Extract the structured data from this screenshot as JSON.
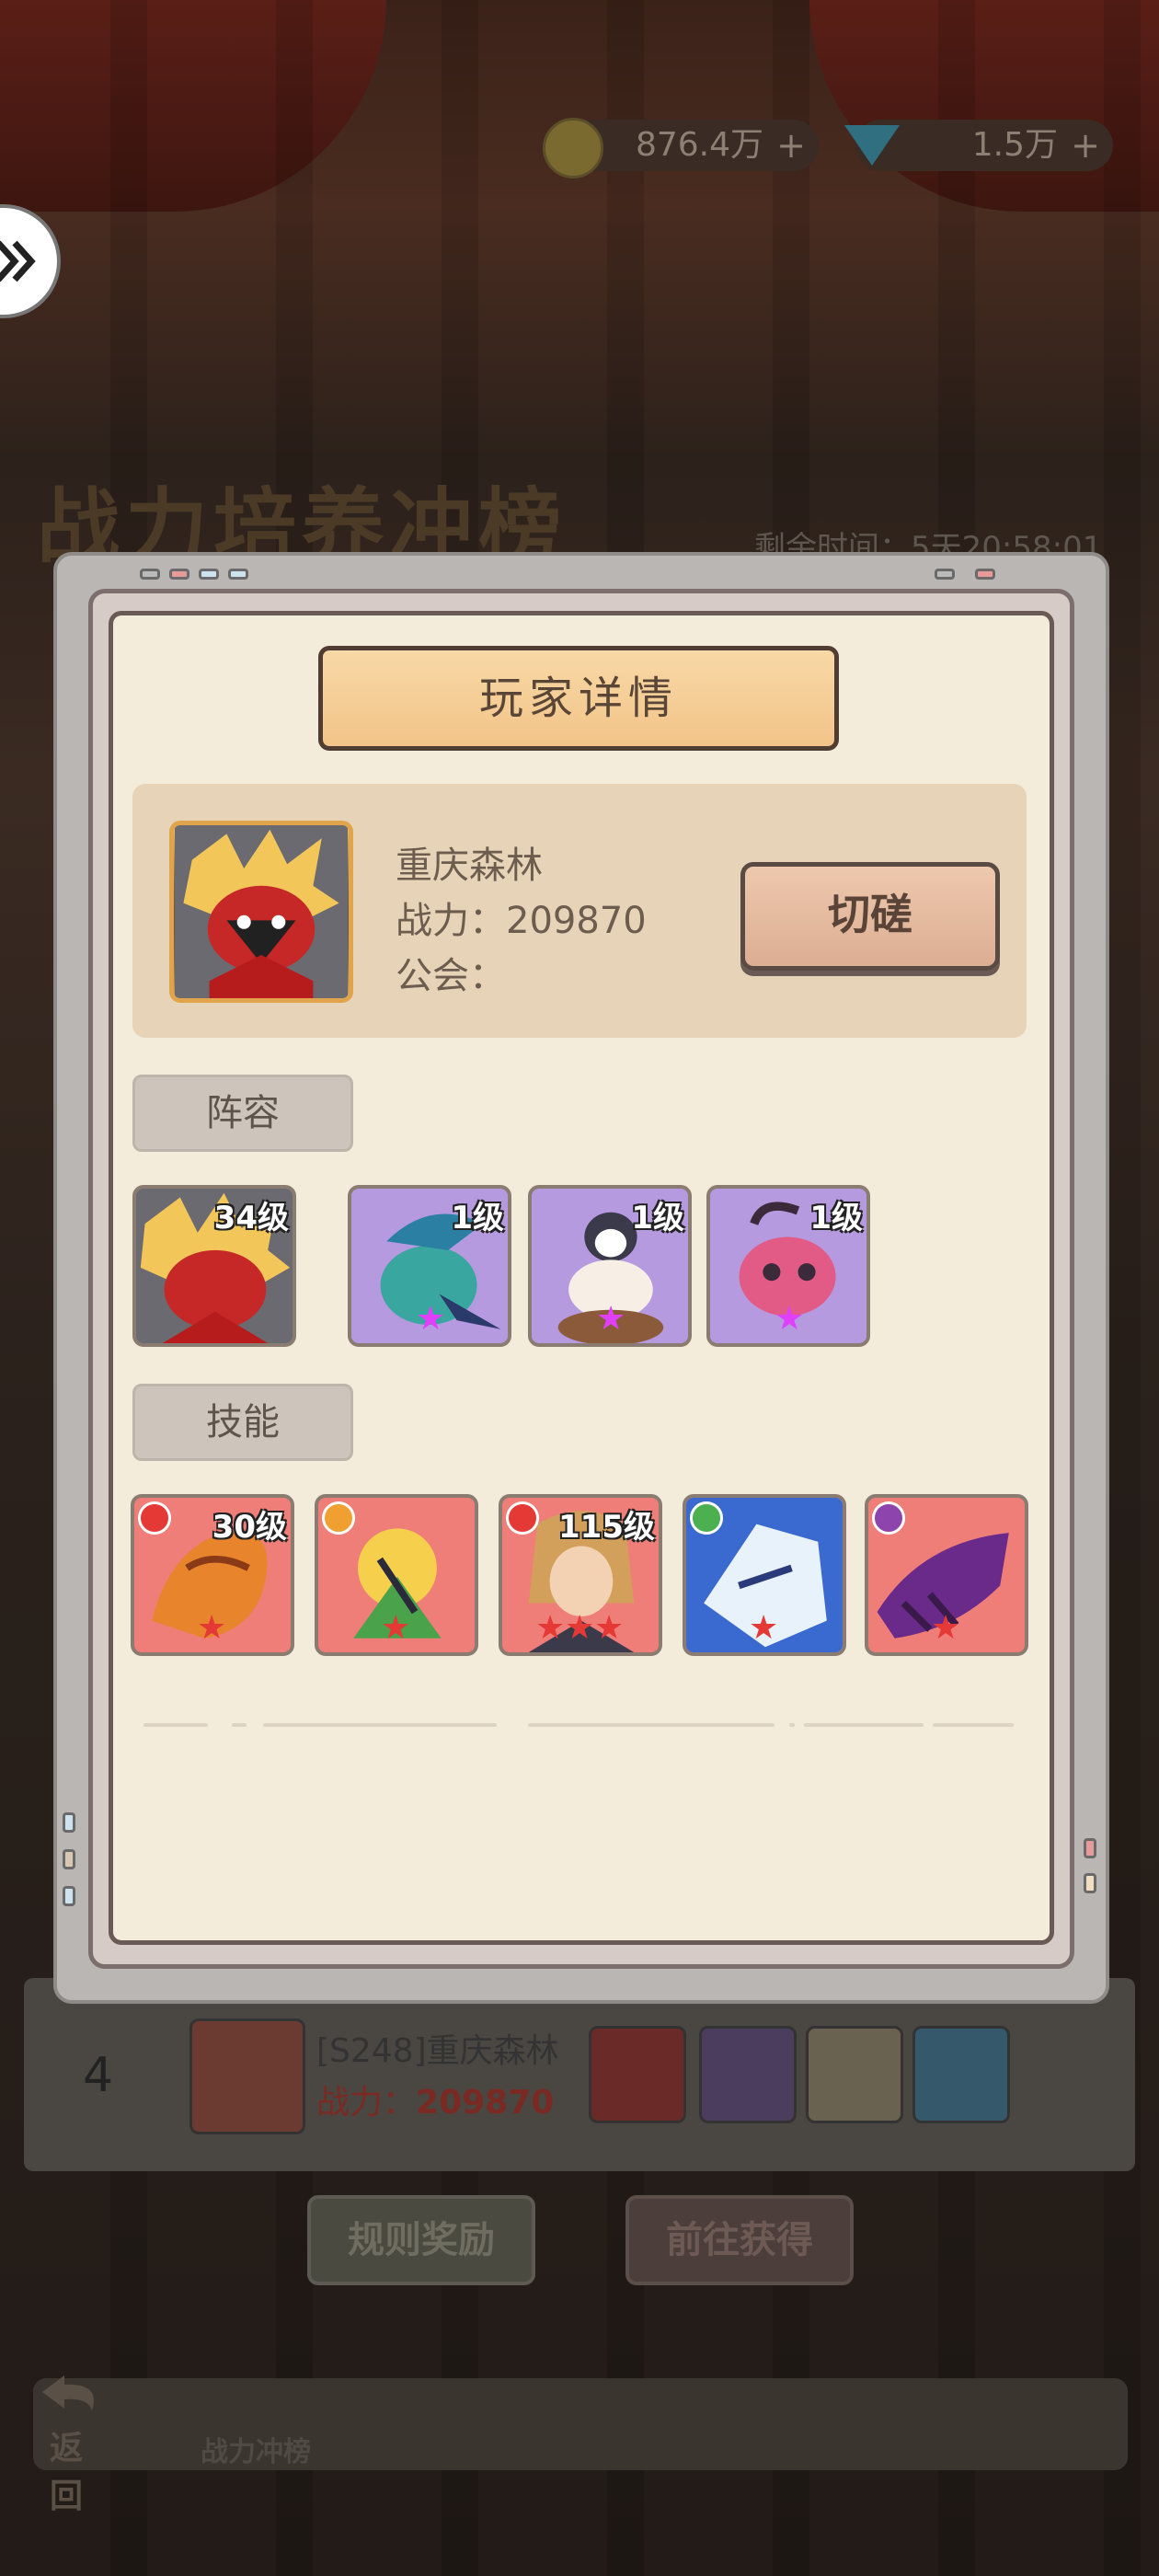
{
  "top_bar": {
    "gold": "876.4万",
    "diamonds": "1.5万",
    "gold_icon": "gold-coin-icon",
    "diamond_icon": "diamond-icon"
  },
  "background": {
    "event_title": "战力培养冲榜",
    "time_remaining": "剩余时间：5天20:58:01",
    "rank_number": "4",
    "rank_player_name": "[S248]重庆森林",
    "rank_power_label": "战力：",
    "rank_power_value": "209870",
    "rules_button": "规则奖励",
    "goto_button": "前往获得",
    "back_label": "返回",
    "tab_label": "战力冲榜"
  },
  "modal": {
    "title": "玩家详情",
    "player": {
      "name": "重庆森林",
      "power": "战力：209870",
      "guild": "公会："
    },
    "spar_button": "切磋",
    "lineup_label": "阵容",
    "skills_label": "技能",
    "lineup": [
      {
        "level": "34级",
        "stars": 0
      },
      {
        "level": "1级",
        "stars": 1
      },
      {
        "level": "1级",
        "stars": 1
      },
      {
        "level": "1级",
        "stars": 1
      }
    ],
    "skills": [
      {
        "level": "30级",
        "stars": 1
      },
      {
        "level": "",
        "stars": 1
      },
      {
        "level": "115级",
        "stars": 3
      },
      {
        "level": "",
        "stars": 1
      },
      {
        "level": "",
        "stars": 1
      }
    ]
  },
  "colors": {
    "panel_bg": "#f4ecdb",
    "banner": "#f2c489",
    "skill_card": "#f07e78",
    "hero_card_purple": "#b69ae0"
  }
}
